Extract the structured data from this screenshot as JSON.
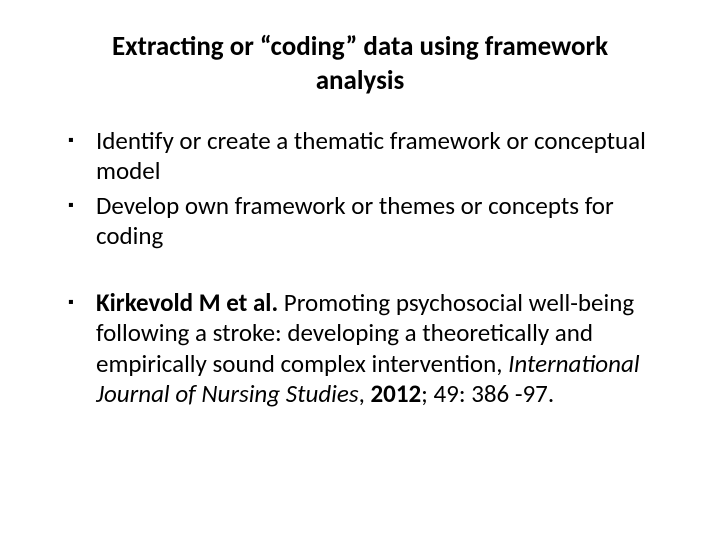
{
  "title": "Extracting or “coding” data using framework analysis",
  "points_a": [
    "Identify or create a thematic framework or conceptual model",
    "Develop own framework or themes or concepts for coding"
  ],
  "citation": {
    "author": "Kirkevold M et al.",
    "text_middle": " Promoting psychosocial well-being following a stroke: developing a theoretically and empirically sound complex intervention, ",
    "journal": "International Journal of Nursing Studies",
    "tail_pre_year": ", ",
    "year": "2012",
    "tail_post": "; 49: 386 -97."
  }
}
